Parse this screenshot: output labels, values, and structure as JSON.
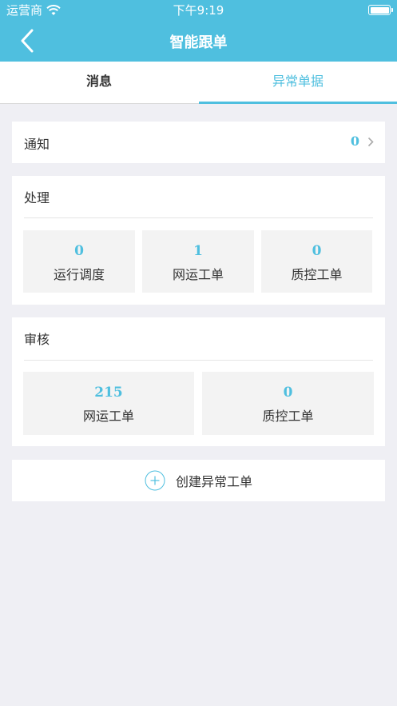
{
  "status_bar": {
    "carrier": "运营商",
    "time": "下午9:19",
    "wifi_icon": "wifi-icon",
    "battery_icon": "battery-icon"
  },
  "nav": {
    "title": "智能跟单",
    "back_icon": "chevron-left-icon"
  },
  "tabs": [
    {
      "label": "消息",
      "active": false
    },
    {
      "label": "异常单据",
      "active": true
    }
  ],
  "notice": {
    "label": "通知",
    "count": "0"
  },
  "process": {
    "title": "处理",
    "tiles": [
      {
        "count": "0",
        "label": "运行调度"
      },
      {
        "count": "1",
        "label": "网运工单"
      },
      {
        "count": "0",
        "label": "质控工单"
      }
    ]
  },
  "review": {
    "title": "审核",
    "tiles": [
      {
        "count": "215",
        "label": "网运工单"
      },
      {
        "count": "0",
        "label": "质控工单"
      }
    ]
  },
  "create": {
    "label": "创建异常工单",
    "icon": "plus-circle-icon"
  },
  "colors": {
    "accent": "#4fbfdf",
    "background": "#efeff4",
    "tile": "#f3f3f3"
  }
}
